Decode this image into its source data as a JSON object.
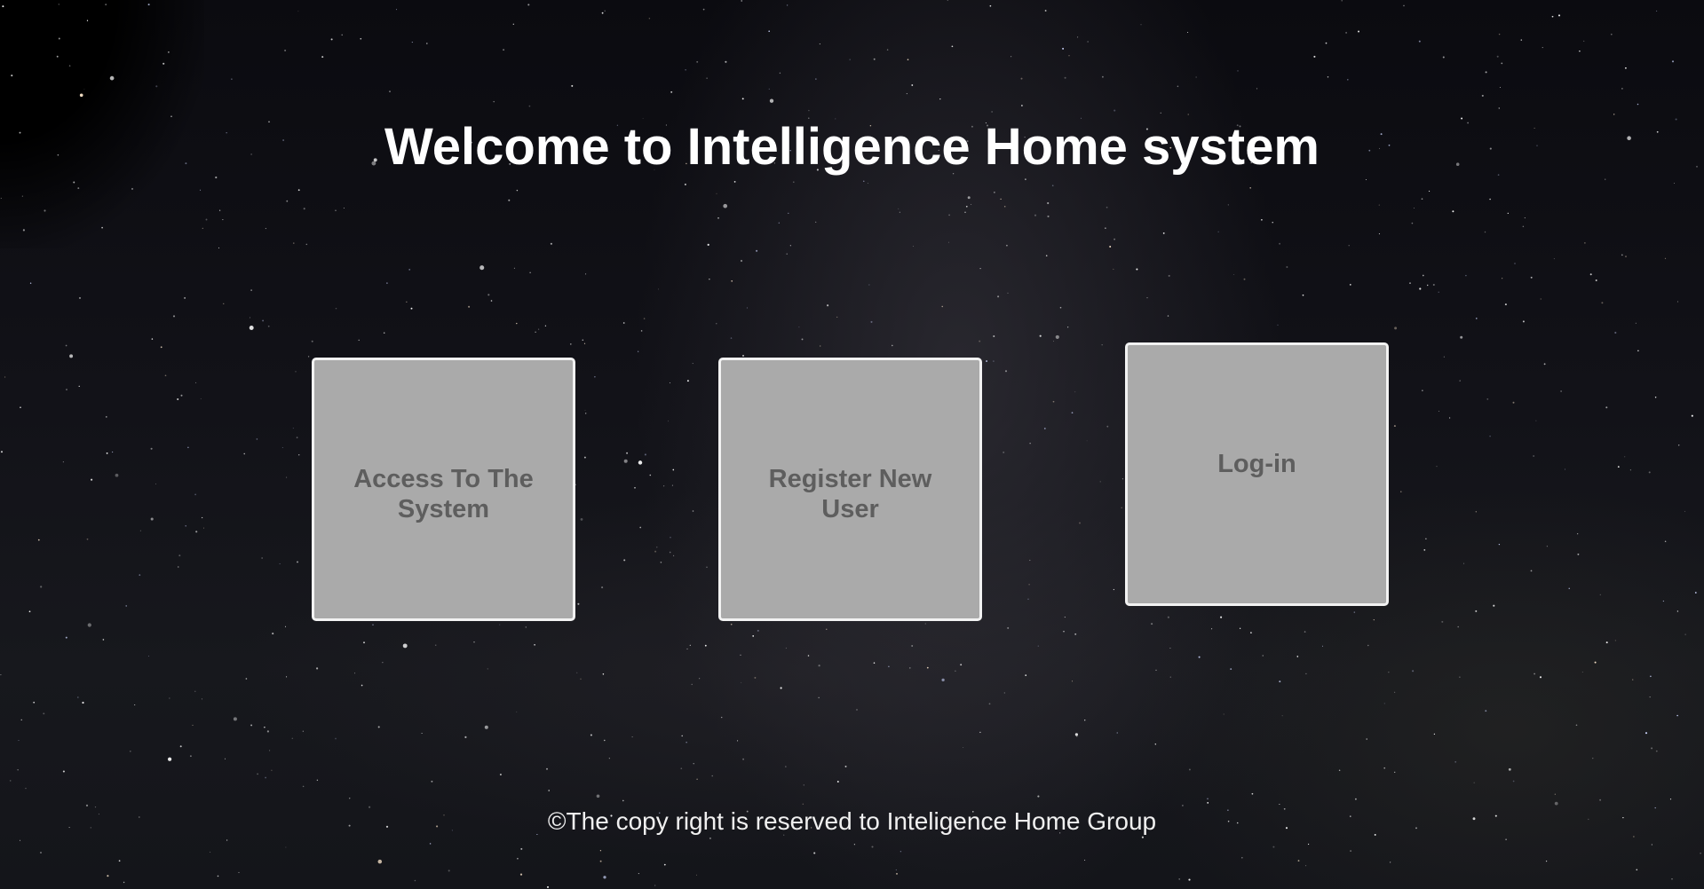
{
  "page": {
    "title": "Welcome to Intelligence Home system"
  },
  "tiles": [
    {
      "label": "Access To The System"
    },
    {
      "label": "Register New User"
    },
    {
      "label": "Log-in"
    }
  ],
  "footer": {
    "copyright": "©The copy right is reserved to Inteligence Home Group"
  },
  "colors": {
    "tile_background": "#aaaaaa",
    "tile_border": "#f2f2f2",
    "tile_text": "#5e5e5e",
    "title_text": "#ffffff",
    "background": "#121218"
  },
  "background": {
    "icon": "starry-night-sky"
  }
}
